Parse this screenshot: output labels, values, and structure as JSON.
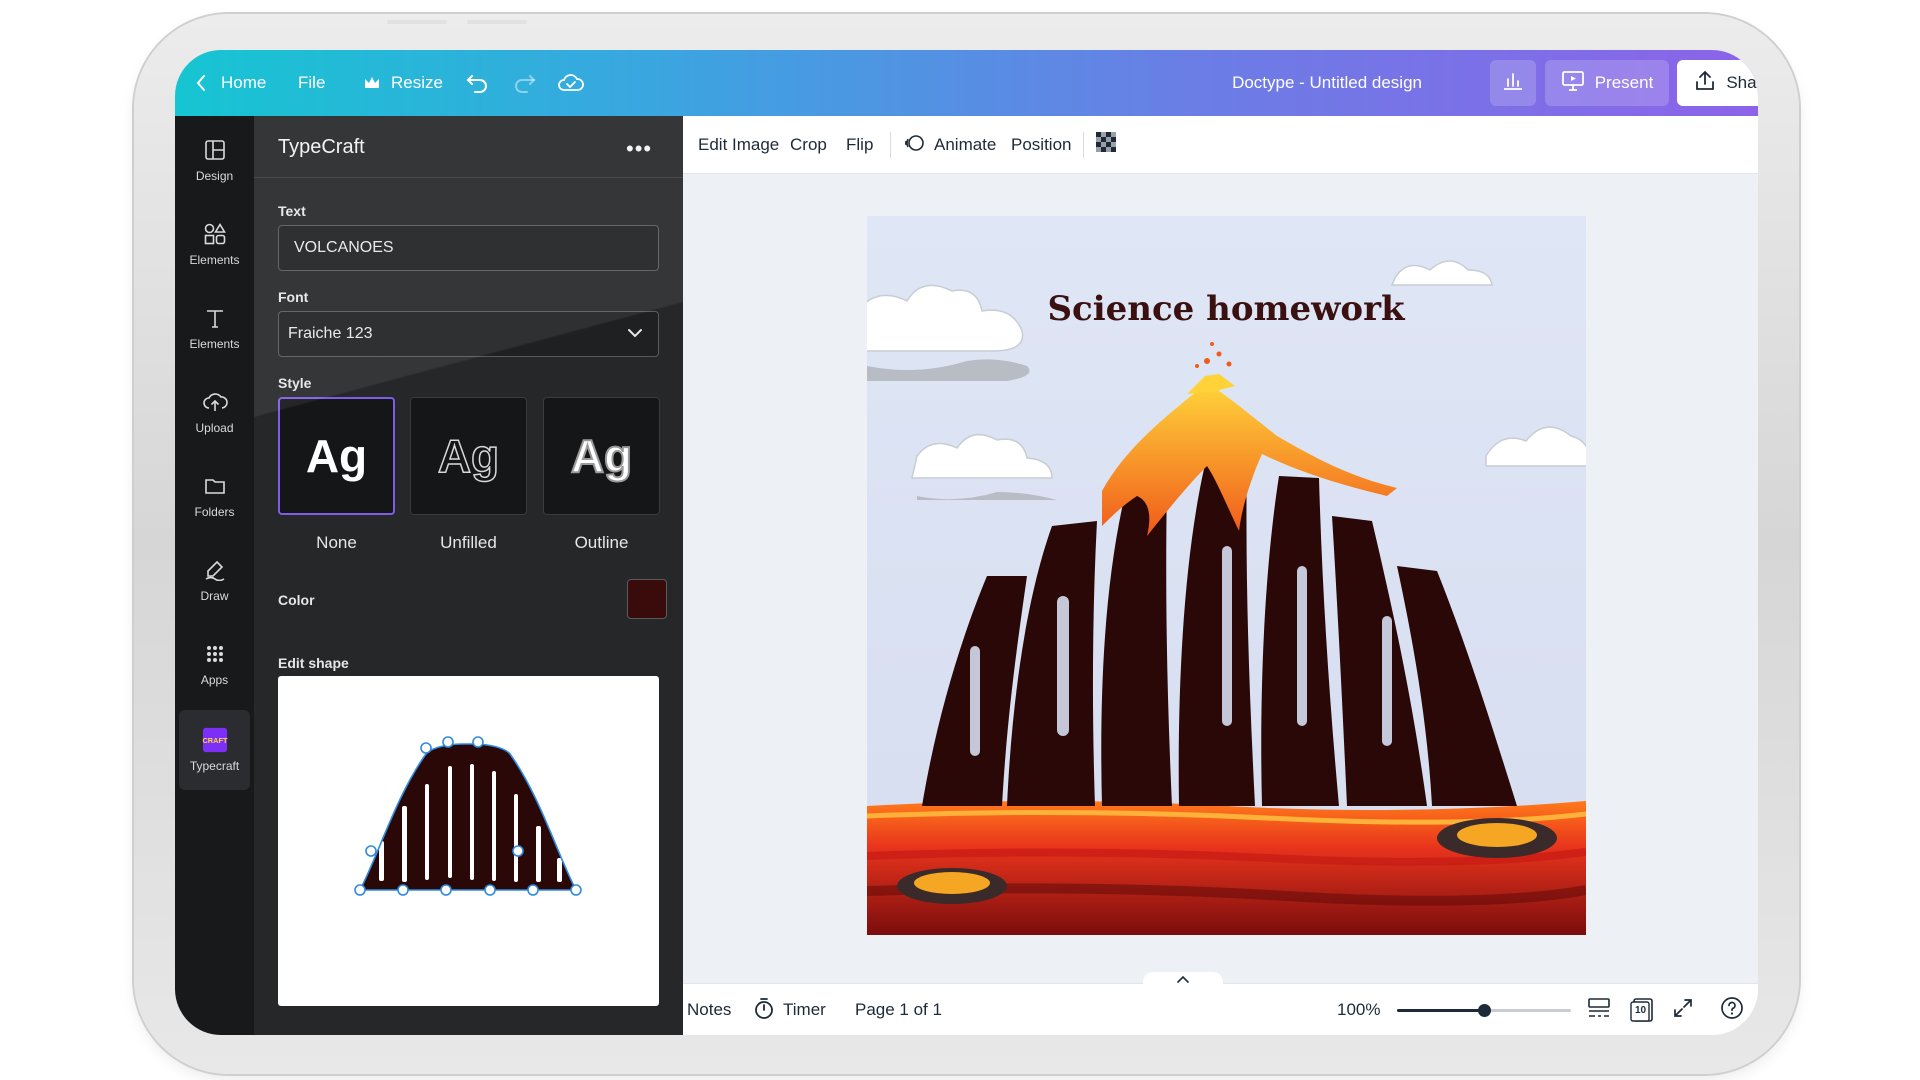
{
  "topbar": {
    "home_label": "Home",
    "file_label": "File",
    "resize_label": "Resize",
    "doc_title": "Doctype - Untitled design",
    "present_label": "Present",
    "share_label": "Share"
  },
  "rail": {
    "items": [
      {
        "label": "Design",
        "icon": "layout-icon"
      },
      {
        "label": "Elements",
        "icon": "shapes-icon"
      },
      {
        "label": "Elements",
        "icon": "text-icon"
      },
      {
        "label": "Upload",
        "icon": "cloud-upload-icon"
      },
      {
        "label": "Folders",
        "icon": "folder-icon"
      },
      {
        "label": "Draw",
        "icon": "draw-icon"
      },
      {
        "label": "Apps",
        "icon": "apps-grid-icon"
      },
      {
        "label": "Typecraft",
        "icon": "typecraft-app-icon"
      }
    ],
    "typecraft_logo_text": "CRAFT"
  },
  "panel": {
    "title": "TypeCraft",
    "text_label": "Text",
    "text_value": "VOLCANOES",
    "font_label": "Font",
    "font_value": "Fraiche 123",
    "style_label": "Style",
    "style_options": [
      {
        "label": "None",
        "sample": "Ag"
      },
      {
        "label": "Unfilled",
        "sample": "Ag"
      },
      {
        "label": "Outline",
        "sample": "Ag"
      }
    ],
    "selected_style": "None",
    "color_label": "Color",
    "color_value": "#3a0b0b",
    "edit_shape_label": "Edit shape",
    "shape_preview_text": "VOLCANOES"
  },
  "toolbar": {
    "edit_image": "Edit Image",
    "crop": "Crop",
    "flip": "Flip",
    "animate": "Animate",
    "position": "Position"
  },
  "canvas": {
    "heading": "Science homework",
    "art_text": "VOLCANOES"
  },
  "bottombar": {
    "notes": "Notes",
    "timer": "Timer",
    "page_indicator": "Page 1 of 1",
    "zoom": "100%",
    "zoom_level": 0.5,
    "page_count_badge": "10"
  },
  "colors": {
    "topbar_gradient_start": "#16c5d2",
    "topbar_gradient_end": "#8c63e8",
    "panel_bg": "#262729",
    "rail_bg": "#18191b",
    "accent": "#7d5ce6",
    "text_fill": "#3a0b0b"
  }
}
